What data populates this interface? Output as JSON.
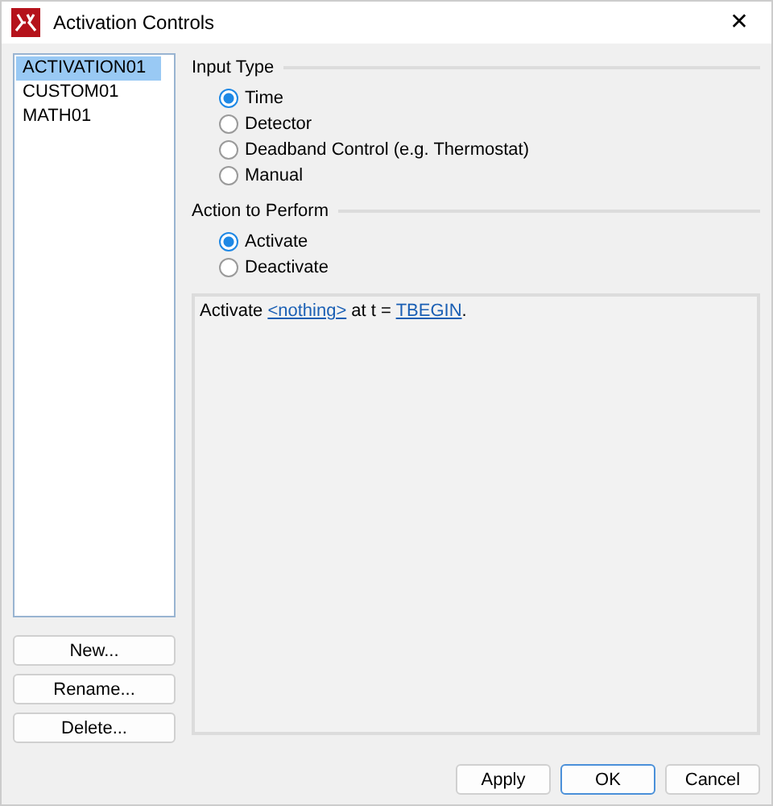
{
  "window": {
    "title": "Activation Controls",
    "close": "✕"
  },
  "list": {
    "items": [
      {
        "label": "ACTIVATION01",
        "selected": true
      },
      {
        "label": "CUSTOM01",
        "selected": false
      },
      {
        "label": "MATH01",
        "selected": false
      }
    ]
  },
  "list_buttons": [
    "New...",
    "Rename...",
    "Delete..."
  ],
  "groups": [
    {
      "title": "Input Type",
      "options": [
        {
          "label": "Time",
          "selected": true
        },
        {
          "label": "Detector",
          "selected": false
        },
        {
          "label": "Deadband Control (e.g. Thermostat)",
          "selected": false
        },
        {
          "label": "Manual",
          "selected": false
        }
      ]
    },
    {
      "title": "Action to Perform",
      "options": [
        {
          "label": "Activate",
          "selected": true
        },
        {
          "label": "Deactivate",
          "selected": false
        }
      ]
    }
  ],
  "description": [
    {
      "kind": "text",
      "text": "Activate "
    },
    {
      "kind": "link",
      "text": "<nothing>"
    },
    {
      "kind": "text",
      "text": " at t = "
    },
    {
      "kind": "link",
      "text": "TBEGIN"
    },
    {
      "kind": "text",
      "text": "."
    }
  ],
  "buttons": [
    {
      "label": "Apply",
      "default": false
    },
    {
      "label": "OK",
      "default": true
    },
    {
      "label": "Cancel",
      "default": false
    }
  ]
}
